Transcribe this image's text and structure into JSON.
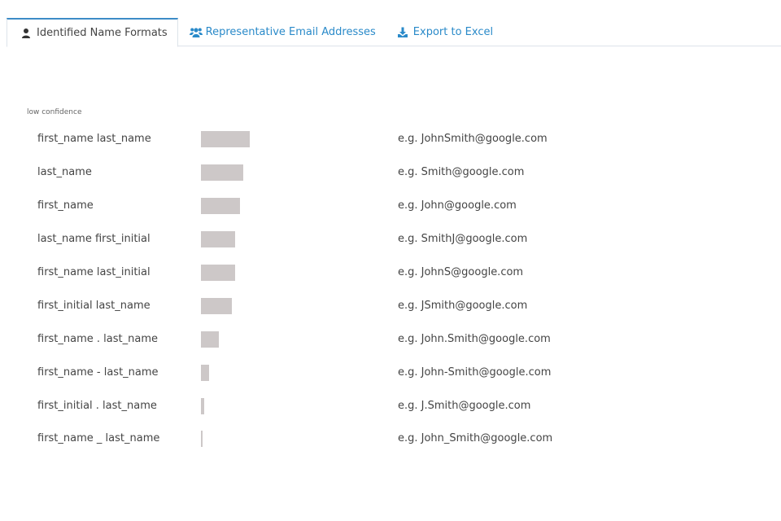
{
  "tabs": [
    {
      "label": "Identified Name Formats",
      "icon": "user-icon",
      "active": true
    },
    {
      "label": "Representative Email Addresses",
      "icon": "users-icon",
      "active": false
    },
    {
      "label": "Export to Excel",
      "icon": "download-icon",
      "active": false
    }
  ],
  "colors": {
    "accent": "#2a8ac9",
    "active_tab_border": "#3d8cc7",
    "bar": "#cdc8c8",
    "text": "#444444"
  },
  "section_label": "low confidence",
  "formats": [
    {
      "format": "first_name last_name",
      "share": 0.3,
      "example": "e.g. JohnSmith@google.com"
    },
    {
      "format": "last_name",
      "share": 0.26,
      "example": "e.g. Smith@google.com"
    },
    {
      "format": "first_name",
      "share": 0.24,
      "example": "e.g. John@google.com"
    },
    {
      "format": "last_name first_initial",
      "share": 0.21,
      "example": "e.g. SmithJ@google.com"
    },
    {
      "format": "first_name last_initial",
      "share": 0.21,
      "example": "e.g. JohnS@google.com"
    },
    {
      "format": "first_initial last_name",
      "share": 0.19,
      "example": "e.g. JSmith@google.com"
    },
    {
      "format": "first_name . last_name",
      "share": 0.11,
      "example": "e.g. John.Smith@google.com"
    },
    {
      "format": "first_name - last_name",
      "share": 0.05,
      "example": "e.g. John-Smith@google.com"
    },
    {
      "format": "first_initial . last_name",
      "share": 0.02,
      "example": "e.g. J.Smith@google.com"
    },
    {
      "format": "first_name _ last_name",
      "share": 0.01,
      "example": "e.g. John_Smith@google.com"
    }
  ]
}
